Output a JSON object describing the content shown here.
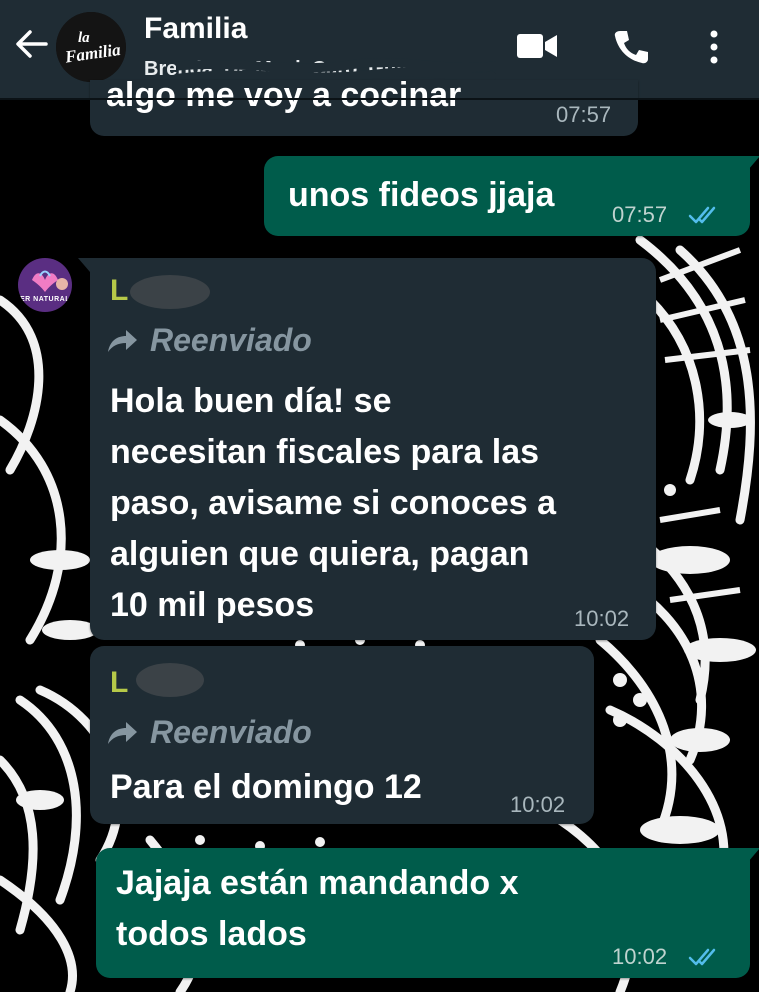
{
  "header": {
    "back_icon": "arrow-left-icon",
    "avatar_logo_line1": "la",
    "avatar_logo_line2": "Familia",
    "title": "Familia",
    "subtitle": "Brenda, De Maui, Caro, Guille",
    "video_icon": "video-camera-icon",
    "call_icon": "phone-icon",
    "menu_icon": "more-vertical-icon"
  },
  "messages": [
    {
      "direction": "in",
      "text": "algo me voy a cocinar",
      "time": "07:57"
    },
    {
      "direction": "out",
      "text": "unos fideos jjaja",
      "time": "07:57",
      "status": "read"
    },
    {
      "direction": "in",
      "sender": "L",
      "avatar_label": "ER NATURAL",
      "forwarded_label": "Reenviado",
      "lines": [
        "Hola buen día! se",
        "necesitan fiscales para las",
        "paso, avisame si conoces a",
        "alguien que quiera, pagan",
        "10 mil pesos"
      ],
      "time": "10:02"
    },
    {
      "direction": "in",
      "sender": "L",
      "forwarded_label": "Reenviado",
      "text": "Para el domingo 12",
      "time": "10:02"
    },
    {
      "direction": "out",
      "lines": [
        "Jajaja están mandando x",
        "todos lados"
      ],
      "time": "10:02",
      "status": "read"
    }
  ],
  "colors": {
    "header_bg": "#1f2c34",
    "incoming_bubble": "#1f2c34",
    "outgoing_bubble": "#005c4b",
    "read_ticks": "#53bdeb",
    "sender_name": "#b6c948"
  }
}
